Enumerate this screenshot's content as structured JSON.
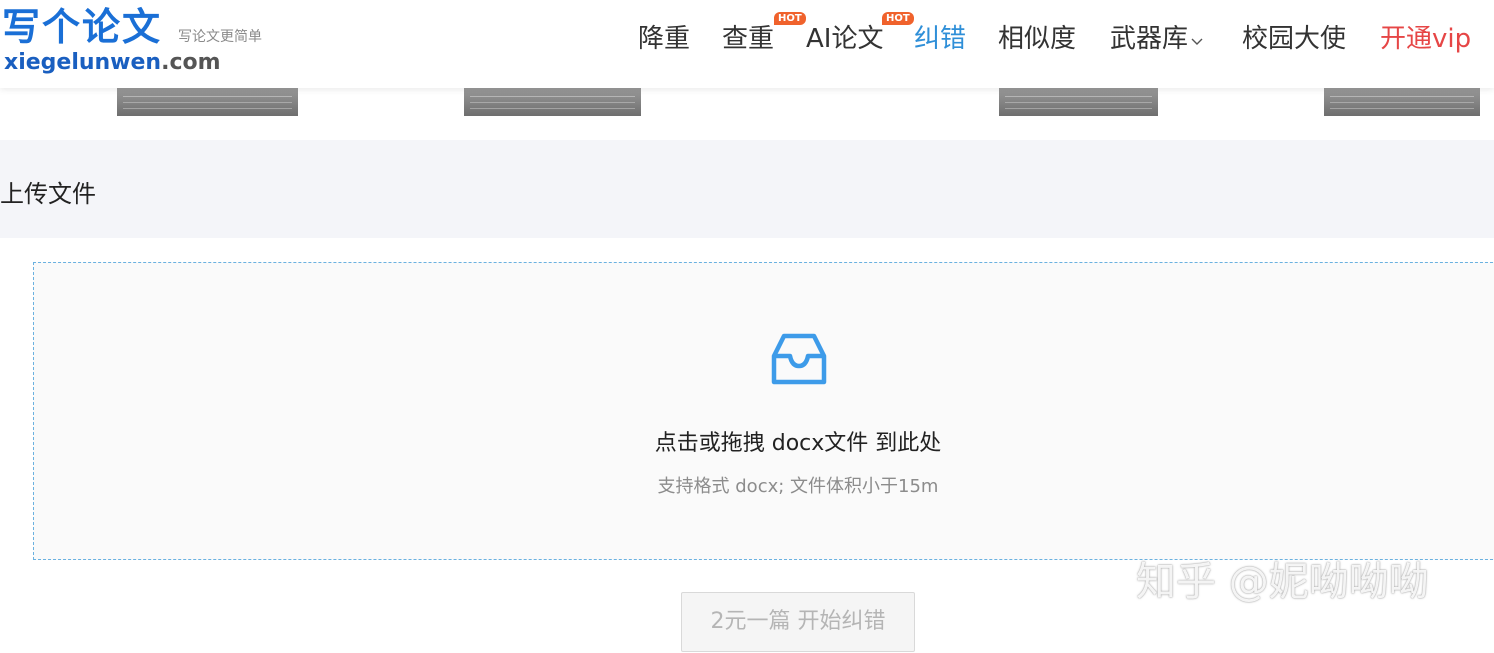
{
  "header": {
    "logo_cn": "写个论文",
    "logo_slogan": "写论文更简单",
    "logo_en_main": "xiegelunwen",
    "logo_en_domain": ".com",
    "nav": [
      {
        "label": "降重",
        "name": "nav-jiangzhong"
      },
      {
        "label": "查重",
        "name": "nav-chachong",
        "badge": "HOT"
      },
      {
        "label": "AI论文",
        "name": "nav-ai-lunwen",
        "badge": "HOT"
      },
      {
        "label": "纠错",
        "name": "nav-jiucuo",
        "active": true
      },
      {
        "label": "相似度",
        "name": "nav-xiangsidu"
      },
      {
        "label": "武器库",
        "name": "nav-wuqiku",
        "has_dropdown": true
      },
      {
        "label": "校园大使",
        "name": "nav-xiaoyuan-dashi"
      },
      {
        "label": "开通vip",
        "name": "nav-vip"
      }
    ],
    "chevron_icon": "chevron-down-icon"
  },
  "upload": {
    "section_title": "上传文件",
    "icon": "inbox-icon",
    "main_text": "点击或拖拽 docx文件 到此处",
    "hint_text": "支持格式 docx; 文件体积小于15m"
  },
  "action": {
    "start_button": "2元一篇 开始纠错"
  },
  "watermark": "知乎 @妮呦呦呦",
  "colors": {
    "brand_blue": "#1a6fd6",
    "active_nav": "#2f8fd8",
    "vip_red": "#e64646",
    "hot_badge": "#f0622c",
    "dropzone_border": "#6ab1e0",
    "upload_icon": "#3d9be9"
  }
}
